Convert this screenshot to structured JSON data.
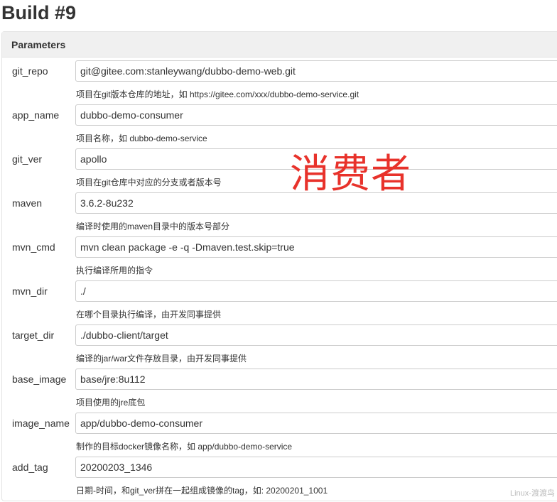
{
  "page_title": "Build #9",
  "panel_title": "Parameters",
  "annotation": "消费者",
  "watermark": "Linux-渡渡鸟",
  "params": [
    {
      "name": "git_repo",
      "value": "git@gitee.com:stanleywang/dubbo-demo-web.git",
      "description": "项目在git版本仓库的地址，如 https://gitee.com/xxx/dubbo-demo-service.git"
    },
    {
      "name": "app_name",
      "value": "dubbo-demo-consumer",
      "description": "项目名称，如 dubbo-demo-service"
    },
    {
      "name": "git_ver",
      "value": "apollo",
      "description": "项目在git仓库中对应的分支或者版本号"
    },
    {
      "name": "maven",
      "value": "3.6.2-8u232",
      "description": "编译时使用的maven目录中的版本号部分"
    },
    {
      "name": "mvn_cmd",
      "value": "mvn clean package -e -q -Dmaven.test.skip=true",
      "description": "执行编译所用的指令"
    },
    {
      "name": "mvn_dir",
      "value": "./",
      "description": "在哪个目录执行编译，由开发同事提供"
    },
    {
      "name": "target_dir",
      "value": "./dubbo-client/target",
      "description": "编译的jar/war文件存放目录，由开发同事提供"
    },
    {
      "name": "base_image",
      "value": "base/jre:8u112",
      "description": "项目使用的jre底包"
    },
    {
      "name": "image_name",
      "value": "app/dubbo-demo-consumer",
      "description": "制作的目标docker镜像名称，如 app/dubbo-demo-service"
    },
    {
      "name": "add_tag",
      "value": "20200203_1346",
      "description": "日期-时间，和git_ver拼在一起组成镜像的tag，如: 20200201_1001"
    }
  ]
}
